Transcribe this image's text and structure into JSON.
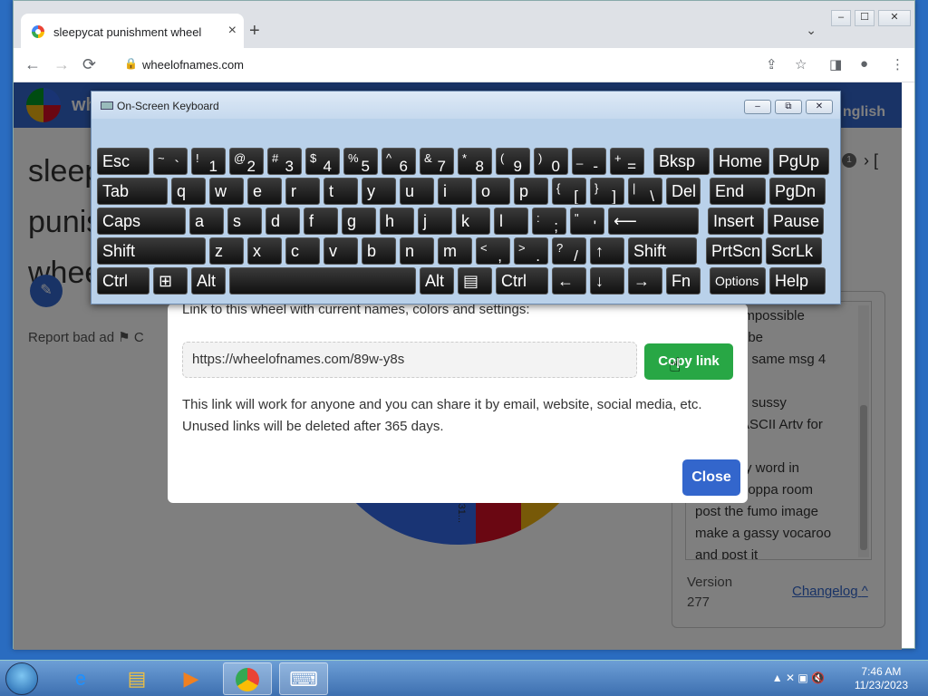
{
  "browser": {
    "tab_title": "sleepycat punishment wheel",
    "tab_close": "×",
    "new_tab": "+",
    "tab_dropdown": "⌄",
    "url": "wheelofnames.com",
    "window_controls": [
      "‒",
      "☐",
      "✕"
    ],
    "back": "←",
    "forward": "→",
    "reload": "⟳",
    "lock": "🔒",
    "share": "⇪",
    "bookmark": "☆",
    "sidepanel": "◨",
    "profile": "●",
    "menu": "⋮"
  },
  "site": {
    "name": "wh",
    "language": "nglish",
    "wheel_title": "sleepycat punishment wheel",
    "edit": "✎",
    "report_ad": "Report bad ad  ⚑   C",
    "count_badge": "1",
    "nav_next": "› [",
    "wheel_label": "r 31...",
    "entries": [
      "impossible",
      "ube",
      "e same msg 4",
      "",
      "e sussy",
      "ASCII Artv for",
      "",
      "ry word in",
      "hoppa room",
      "post the fumo image",
      "make a gassy vocaroo",
      "and post it"
    ],
    "version_label": "Version",
    "version_number": "277",
    "changelog": "Changelog",
    "changelog_icon": "^"
  },
  "modal": {
    "intro": "Link to this wheel with current names, colors and settings:",
    "link": "https://wheelofnames.com/89w-y8s",
    "copy_button": "Copy link",
    "note_line1": "This link will work for anyone and you can share it by email, website, social media, etc.",
    "note_line2": "Unused links will be deleted after 365 days.",
    "close_button": "Close"
  },
  "osk": {
    "title": "On-Screen Keyboard",
    "title_buttons": [
      "‒",
      "⧉",
      "✕"
    ],
    "rows": [
      [
        {
          "l": "Esc"
        },
        {
          "s": "~",
          "m": "`"
        },
        {
          "s": "!",
          "m": "1"
        },
        {
          "s": "@",
          "m": "2"
        },
        {
          "s": "#",
          "m": "3"
        },
        {
          "s": "$",
          "m": "4"
        },
        {
          "s": "%",
          "m": "5"
        },
        {
          "s": "^",
          "m": "6"
        },
        {
          "s": "&",
          "m": "7"
        },
        {
          "s": "*",
          "m": "8"
        },
        {
          "s": "(",
          "m": "9"
        },
        {
          "s": ")",
          "m": "0"
        },
        {
          "s": "_",
          "m": "-"
        },
        {
          "s": "+",
          "m": "="
        },
        {
          "l": "Bksp"
        },
        {
          "l": "Home"
        },
        {
          "l": "PgUp"
        }
      ],
      [
        {
          "l": "Tab"
        },
        {
          "l": "q"
        },
        {
          "l": "w"
        },
        {
          "l": "e"
        },
        {
          "l": "r"
        },
        {
          "l": "t"
        },
        {
          "l": "y"
        },
        {
          "l": "u"
        },
        {
          "l": "i"
        },
        {
          "l": "o"
        },
        {
          "l": "p"
        },
        {
          "s": "{",
          "m": "["
        },
        {
          "s": "}",
          "m": "]"
        },
        {
          "s": "|",
          "m": "\\"
        },
        {
          "l": "Del"
        },
        {
          "l": "End"
        },
        {
          "l": "PgDn"
        }
      ],
      [
        {
          "l": "Caps"
        },
        {
          "l": "a"
        },
        {
          "l": "s"
        },
        {
          "l": "d"
        },
        {
          "l": "f"
        },
        {
          "l": "g"
        },
        {
          "l": "h"
        },
        {
          "l": "j"
        },
        {
          "l": "k"
        },
        {
          "l": "l"
        },
        {
          "s": ":",
          "m": ";"
        },
        {
          "s": "\"",
          "m": "'"
        },
        {
          "l": "⟵"
        },
        {
          "l": "Insert"
        },
        {
          "l": "Pause"
        }
      ],
      [
        {
          "l": "Shift"
        },
        {
          "l": "z"
        },
        {
          "l": "x"
        },
        {
          "l": "c"
        },
        {
          "l": "v"
        },
        {
          "l": "b"
        },
        {
          "l": "n"
        },
        {
          "l": "m"
        },
        {
          "s": "<",
          "m": ","
        },
        {
          "s": ">",
          "m": "."
        },
        {
          "s": "?",
          "m": "/"
        },
        {
          "l": "↑"
        },
        {
          "l": "Shift"
        },
        {
          "l": "PrtScn"
        },
        {
          "l": "ScrLk"
        }
      ],
      [
        {
          "l": "Ctrl"
        },
        {
          "l": "⊞"
        },
        {
          "l": "Alt"
        },
        {
          "l": ""
        },
        {
          "l": "Alt"
        },
        {
          "l": "▤"
        },
        {
          "l": "Ctrl"
        },
        {
          "l": "←"
        },
        {
          "l": "↓"
        },
        {
          "l": "→"
        },
        {
          "l": "Fn"
        },
        {
          "l": "Options"
        },
        {
          "l": "Help"
        }
      ]
    ]
  },
  "taskbar": {
    "time": "7:46 AM",
    "date": "11/23/2023",
    "tray_icons": "▲  ✕  ▣  🔇"
  },
  "colors": {
    "brand": "#3366cc",
    "copy": "#28a745"
  }
}
